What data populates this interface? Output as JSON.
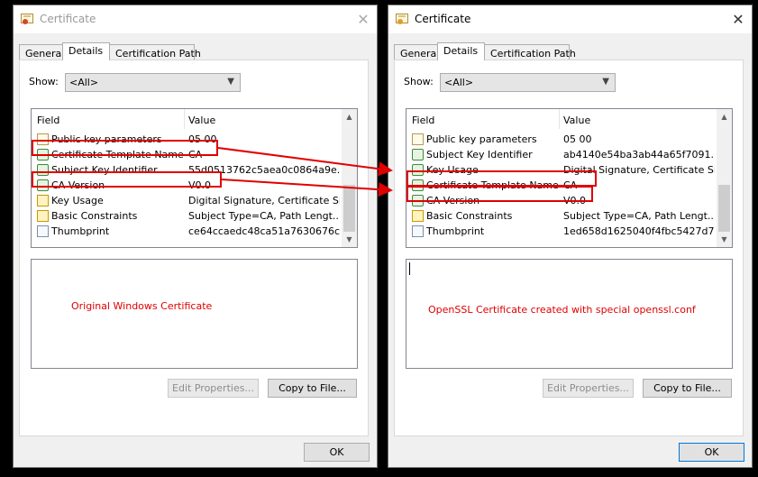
{
  "colors": {
    "annotation": "#e00000",
    "ok_border": "#0078d7"
  },
  "windows": [
    {
      "id": "left",
      "title": "Certificate",
      "close": "✕",
      "tabs": [
        "General",
        "Details",
        "Certification Path"
      ],
      "active_tab": 1,
      "show_label": "Show:",
      "show_value": "<All>",
      "columns": {
        "field": "Field",
        "value": "Value"
      },
      "rows": [
        {
          "icon": "document-icon",
          "field": "Public key parameters",
          "value": "05 00"
        },
        {
          "icon": "extension-icon",
          "field": "Certificate Template Name",
          "value": "CA"
        },
        {
          "icon": "extension-icon",
          "field": "Subject Key Identifier",
          "value": "55d0513762c5aea0c0864a9e..."
        },
        {
          "icon": "extension-icon",
          "field": "CA Version",
          "value": "V0.0"
        },
        {
          "icon": "critical-extension-icon",
          "field": "Key Usage",
          "value": "Digital Signature, Certificate Si..."
        },
        {
          "icon": "critical-extension-icon",
          "field": "Basic Constraints",
          "value": "Subject Type=CA, Path Lengt..."
        },
        {
          "icon": "property-icon",
          "field": "Thumbprint",
          "value": "ce64ccaedc48ca51a7630676c..."
        }
      ],
      "annotation": "Original Windows Certificate",
      "edit_button": "Edit Properties...",
      "copy_button": "Copy to File...",
      "ok_button": "OK"
    },
    {
      "id": "right",
      "title": "Certificate",
      "close": "✕",
      "tabs": [
        "General",
        "Details",
        "Certification Path"
      ],
      "active_tab": 1,
      "show_label": "Show:",
      "show_value": "<All>",
      "columns": {
        "field": "Field",
        "value": "Value"
      },
      "rows": [
        {
          "icon": "document-icon",
          "field": "Public key parameters",
          "value": "05 00"
        },
        {
          "icon": "extension-icon",
          "field": "Subject Key Identifier",
          "value": "ab4140e54ba3ab44a65f7091..."
        },
        {
          "icon": "extension-icon",
          "field": "Key Usage",
          "value": "Digital Signature, Certificate Si..."
        },
        {
          "icon": "extension-icon",
          "field": "Certificate Template Name",
          "value": "CA"
        },
        {
          "icon": "extension-icon",
          "field": "CA Version",
          "value": "V0.0"
        },
        {
          "icon": "critical-extension-icon",
          "field": "Basic Constraints",
          "value": "Subject Type=CA, Path Lengt..."
        },
        {
          "icon": "property-icon",
          "field": "Thumbprint",
          "value": "1ed658d1625040f4fbc5427d7..."
        }
      ],
      "annotation": "OpenSSL Certificate created with special openssl.conf",
      "edit_button": "Edit Properties...",
      "copy_button": "Copy to File...",
      "ok_button": "OK"
    }
  ]
}
